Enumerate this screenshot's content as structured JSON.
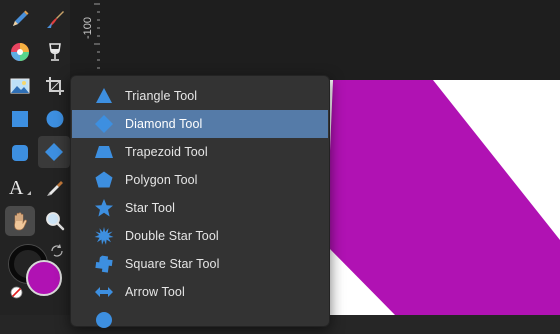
{
  "ruler": {
    "label": "-100"
  },
  "flyout": {
    "items": [
      {
        "label": "Triangle Tool",
        "icon": "triangle-icon",
        "selected": false
      },
      {
        "label": "Diamond Tool",
        "icon": "diamond-icon",
        "selected": true
      },
      {
        "label": "Trapezoid Tool",
        "icon": "trapezoid-icon",
        "selected": false
      },
      {
        "label": "Polygon Tool",
        "icon": "pentagon-icon",
        "selected": false
      },
      {
        "label": "Star Tool",
        "icon": "star-icon",
        "selected": false
      },
      {
        "label": "Double Star Tool",
        "icon": "double-star-icon",
        "selected": false
      },
      {
        "label": "Square Star Tool",
        "icon": "square-star-icon",
        "selected": false
      },
      {
        "label": "Arrow Tool",
        "icon": "arrow-icon",
        "selected": false
      }
    ]
  },
  "colors": {
    "accent": "#4a90d9",
    "selection": "#557ba8",
    "shape_fill": "#b012b3",
    "fill_swatch": "#b012b3"
  }
}
